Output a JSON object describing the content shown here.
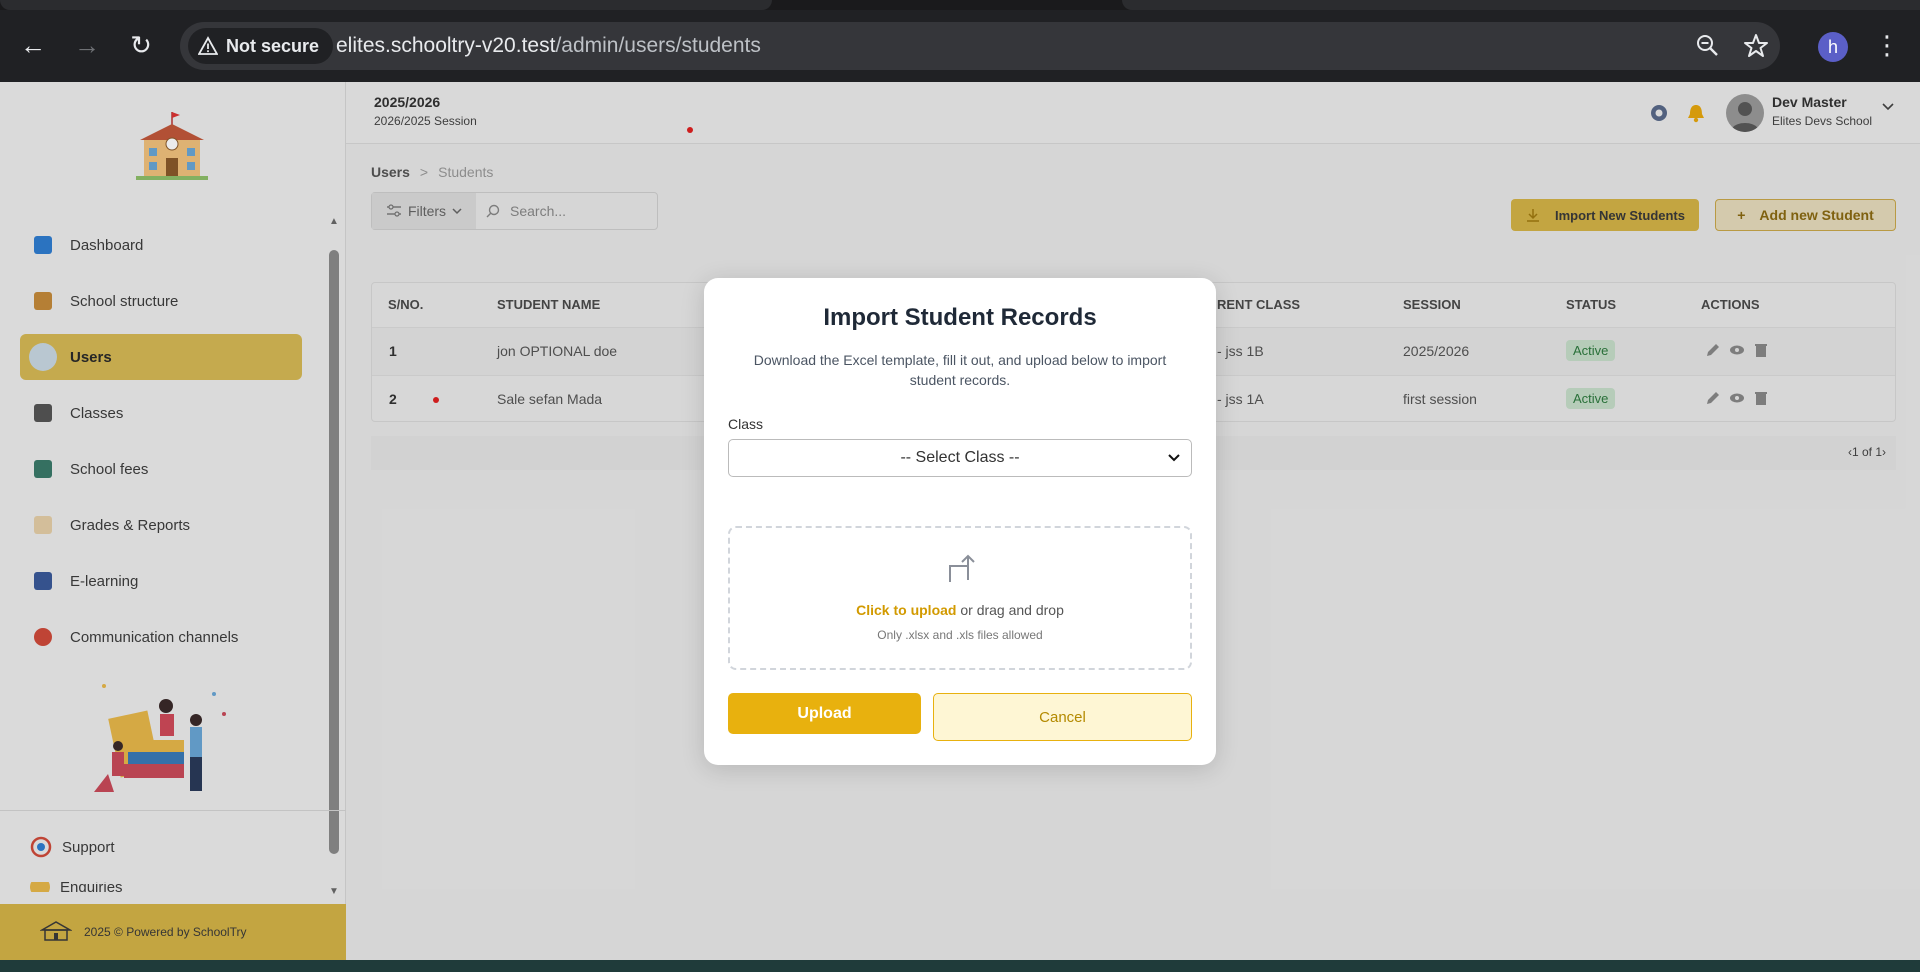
{
  "browser": {
    "security_label": "Not secure",
    "url_host": "elites.schooltry-v20.test",
    "url_path": "/admin/users/students",
    "profile_initial": "h"
  },
  "topbar": {
    "session_title": "2025/2026",
    "session_sub": "2026/2025 Session",
    "user_name": "Dev Master",
    "user_school": "Elites Devs School"
  },
  "sidebar": {
    "items": [
      {
        "label": "Dashboard",
        "active": false,
        "color": "#2f7dd1"
      },
      {
        "label": "School structure",
        "active": false,
        "color": "#c58a3a"
      },
      {
        "label": "Users",
        "active": true,
        "color": "#2f7dd1"
      },
      {
        "label": "Classes",
        "active": false,
        "color": "#444"
      },
      {
        "label": "School fees",
        "active": false,
        "color": "#3a7a6a"
      },
      {
        "label": "Grades & Reports",
        "active": false,
        "color": "#c9a060"
      },
      {
        "label": "E-learning",
        "active": false,
        "color": "#3a5a9a"
      },
      {
        "label": "Communication channels",
        "active": false,
        "color": "#d04a3a"
      }
    ],
    "support_label": "Support",
    "enquiries_label": "Enquiries",
    "footer_text": "2025 © Powered by SchoolTry"
  },
  "page": {
    "breadcrumb_root": "Users",
    "breadcrumb_separator": ">",
    "breadcrumb_current": "Students",
    "filters_label": "Filters",
    "search_placeholder": "Search...",
    "import_button": "Import New Students",
    "add_button": "Add new Student"
  },
  "table": {
    "headers": [
      "S/NO.",
      "STUDENT NAME",
      "RENT CLASS",
      "SESSION",
      "STATUS",
      "ACTIONS"
    ],
    "rows": [
      {
        "sn": "1",
        "name": "jon OPTIONAL doe",
        "class": "- jss 1B",
        "session": "2025/2026",
        "status": "Active"
      },
      {
        "sn": "2",
        "name": "Sale sefan Mada",
        "class": "- jss 1A",
        "session": "first session",
        "status": "Active"
      }
    ],
    "pagination": "1 of 1"
  },
  "modal": {
    "title": "Import Student Records",
    "description": "Download the Excel template, fill it out, and upload below to import student records.",
    "class_label": "Class",
    "class_select_value": "-- Select Class --",
    "upload_click_text": "Click to upload",
    "upload_rest_text": " or drag and drop",
    "upload_hint": "Only .xlsx and .xls files allowed",
    "upload_button": "Upload",
    "cancel_button": "Cancel"
  },
  "colors": {
    "accent": "#e8b10e",
    "accent_muted": "#d4b347",
    "status_active_bg": "#c6dec9",
    "status_active_text": "#2d7a3e"
  }
}
